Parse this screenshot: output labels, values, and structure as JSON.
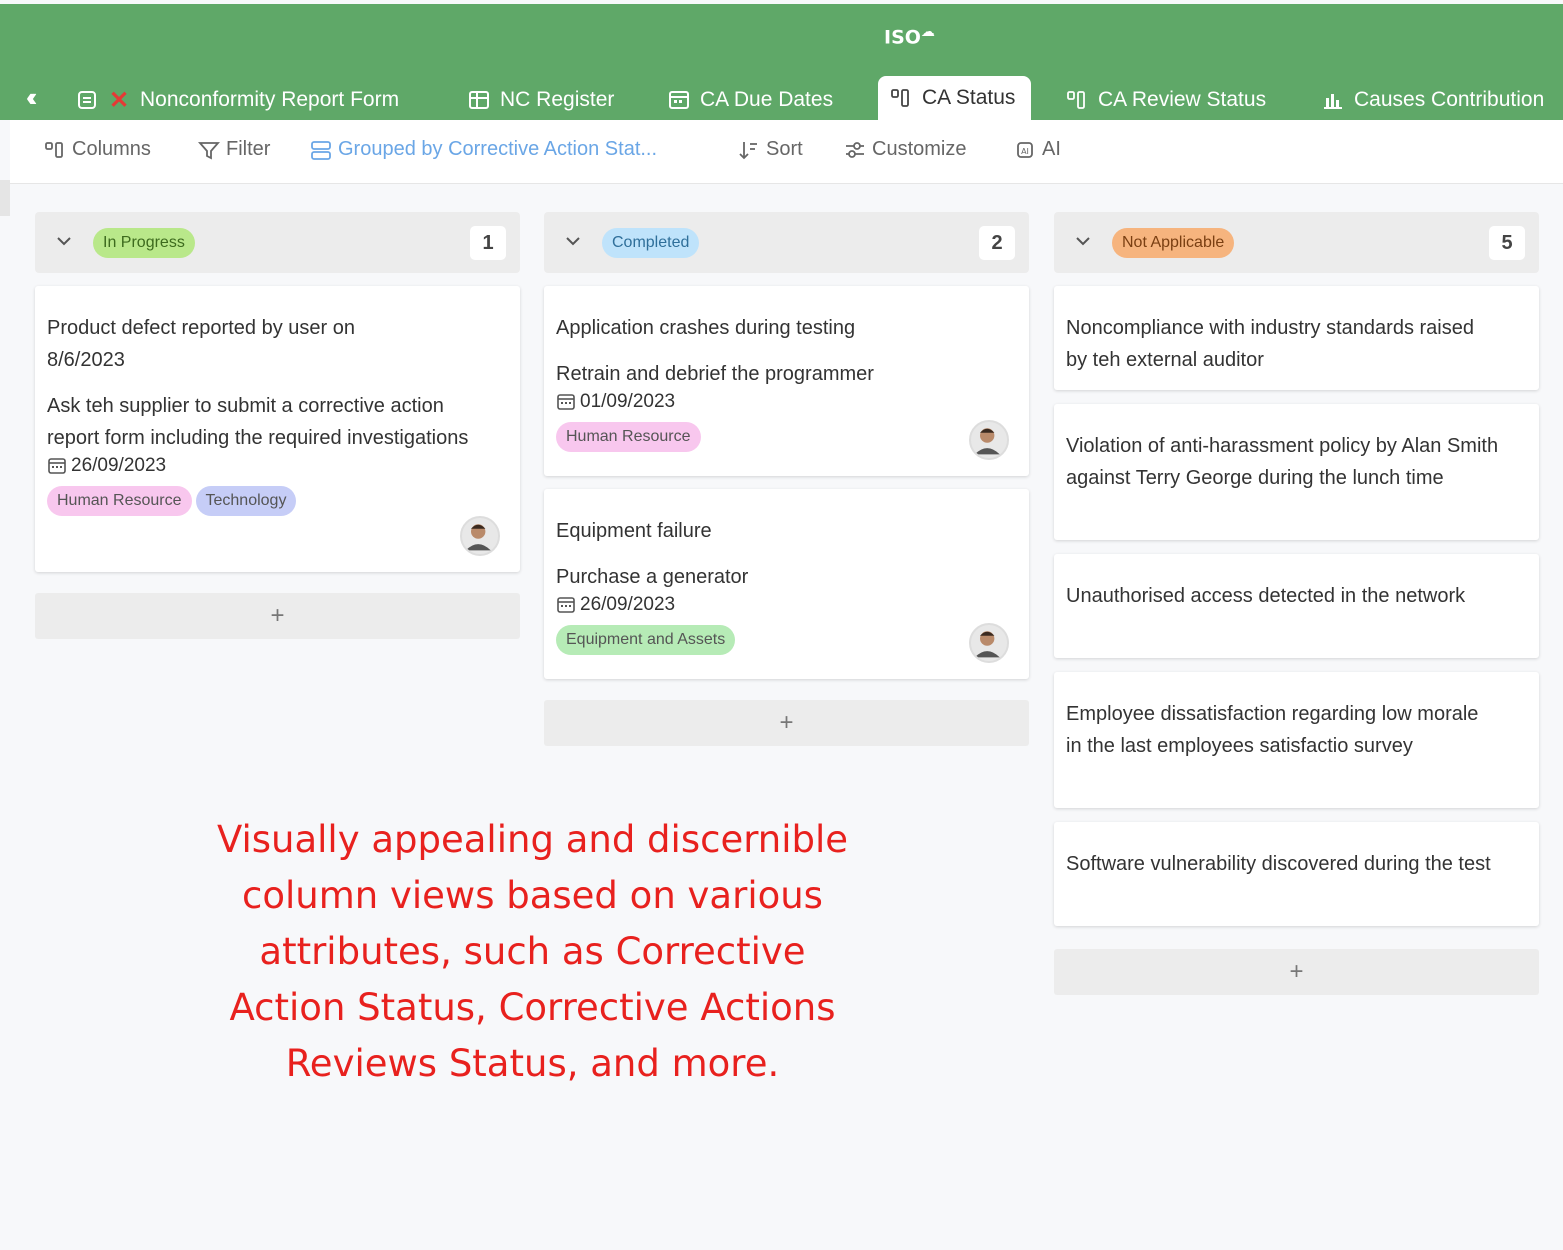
{
  "tabs": [
    {
      "label": "Nonconformity Report Form"
    },
    {
      "label": "NC Register"
    },
    {
      "label": "CA Due Dates"
    },
    {
      "label": "CA Status"
    },
    {
      "label": "CA Review Status"
    },
    {
      "label": "Causes Contribution"
    }
  ],
  "toolbar": {
    "columns": "Columns",
    "filter": "Filter",
    "grouped": "Grouped by Corrective Action Stat...",
    "sort": "Sort",
    "customize": "Customize",
    "ai": "AI"
  },
  "columns": [
    {
      "status": "In Progress",
      "status_bg": "#b9e88a",
      "status_color": "#3d6b1e",
      "count": "1",
      "cards": [
        {
          "title": "Product defect reported by user on 8/6/2023",
          "action": "Ask teh supplier to submit a corrective action report form including the required investigations",
          "date": "26/09/2023",
          "tags": [
            "Human Resource",
            "Technology"
          ]
        }
      ]
    },
    {
      "status": "Completed",
      "status_bg": "#bfe3fb",
      "status_color": "#2f6f9a",
      "count": "2",
      "cards": [
        {
          "title": "Application crashes during testing",
          "action": "Retrain and debrief the programmer",
          "date": "01/09/2023",
          "tags": [
            "Human Resource"
          ]
        },
        {
          "title": "Equipment failure",
          "action": "Purchase a generator",
          "date": "26/09/2023",
          "tags": [
            "Equipment and Assets"
          ]
        }
      ]
    },
    {
      "status": "Not Applicable",
      "status_bg": "#f6b47e",
      "status_color": "#7a3f12",
      "count": "5",
      "cards": [
        {
          "title": "Noncompliance with industry standards raised by teh external auditor"
        },
        {
          "title": "Violation of anti-harassment policy by Alan Smith against Terry George during the lunch time"
        },
        {
          "title": "Unauthorised access detected in the network"
        },
        {
          "title": "Employee dissatisfaction regarding low morale in the last employees satisfactio survey"
        },
        {
          "title": "Software vulnerability discovered during the test"
        }
      ]
    }
  ],
  "tag_colors": {
    "Human Resource": "#f8c7ee",
    "Technology": "#c6cdf7",
    "Equipment and Assets": "#b6ebb6"
  },
  "add_symbol": "+",
  "promo_text": "Visually appealing and discernible column views based on various attributes, such as Corrective Action Status, Corrective Actions Reviews Status, and more."
}
